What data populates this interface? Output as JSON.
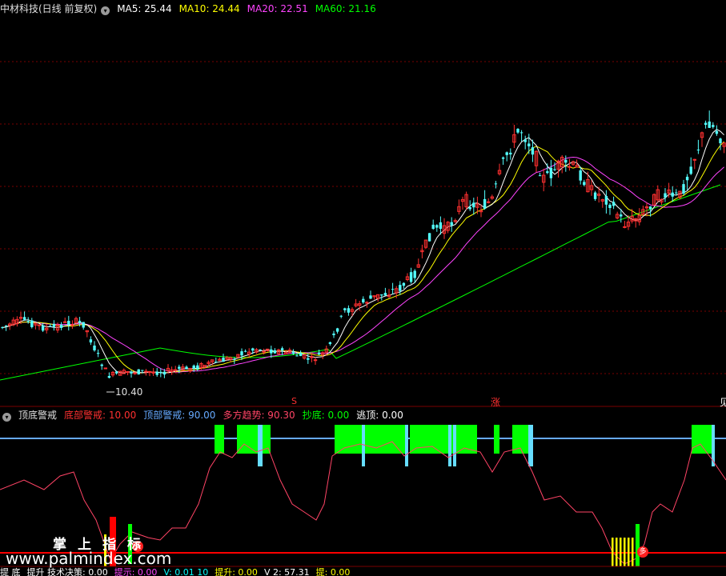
{
  "main_panel": {
    "stock_title": "中材科技(日线 前复权)",
    "indicators": [
      {
        "label": "MA5: 25.44",
        "color": "#ffffff"
      },
      {
        "label": "MA10: 24.44",
        "color": "#ffff00"
      },
      {
        "label": "MA20: 22.51",
        "color": "#ff44ff"
      },
      {
        "label": "MA60: 21.16",
        "color": "#00ff00"
      }
    ],
    "low_label": "10.40",
    "markers": [
      {
        "text": "S",
        "color": "#ff3030"
      },
      {
        "text": "涨",
        "color": "#ff3030"
      },
      {
        "text": "见",
        "color": "#ffffff"
      }
    ]
  },
  "sub_panel": {
    "name": "顶底警戒",
    "indicators": [
      {
        "label": "底部警戒: 10.00",
        "color": "#ff3030"
      },
      {
        "label": "顶部警戒: 90.00",
        "color": "#66aaff"
      },
      {
        "label": "多方趋势: 90.30",
        "color": "#ff4466"
      },
      {
        "label": "抄底: 0.00",
        "color": "#00ff00"
      },
      {
        "label": "逃顶: 0.00",
        "color": "#ffffff"
      }
    ],
    "dot_marker": "多"
  },
  "bottom_strip": [
    {
      "label": "提 底",
      "color": "#ffffff"
    },
    {
      "label": "提升 技术决策: 0.00",
      "color": "#ffffff"
    },
    {
      "label": "提示: 0.00",
      "color": "#ff44ff"
    },
    {
      "label": "V: 0.01 10",
      "color": "#00ffff"
    },
    {
      "label": "提升: 0.00",
      "color": "#ffff00"
    },
    {
      "label": "V 2: 57.31",
      "color": "#ffffff"
    },
    {
      "label": "提: 0.00",
      "color": "#ffff00"
    }
  ],
  "watermark": {
    "chars": "掌上指标",
    "url": "www.palmindex.com"
  },
  "colors": {
    "grid": "#7a0000",
    "up": "#ff3030",
    "down": "#54ffff",
    "ma5": "#ffffff",
    "ma10": "#ffff00",
    "ma20": "#ff44ff",
    "ma60": "#00ff00",
    "trend": "#ff4466",
    "top_line": "#66aaff",
    "bottom_line": "#ff0000",
    "green_block": "#00ff00",
    "cyan_block": "#66ddff"
  }
}
